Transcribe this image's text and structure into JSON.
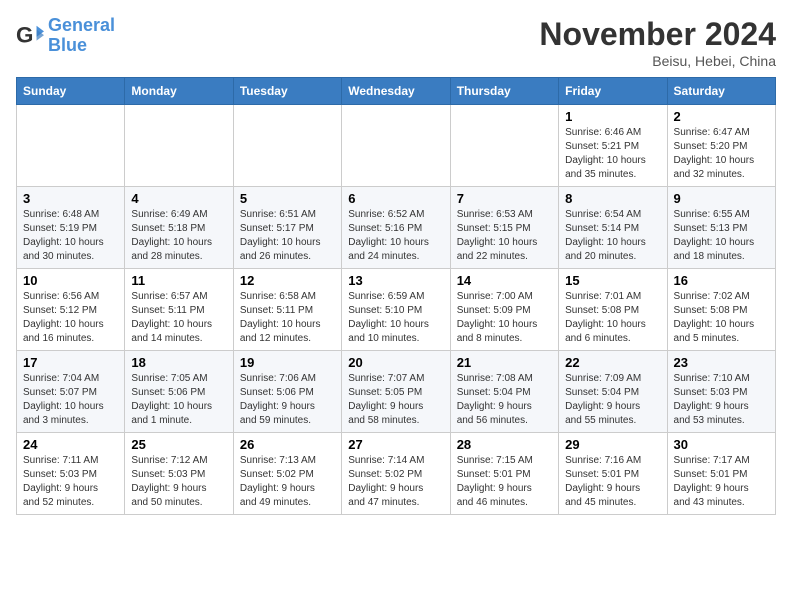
{
  "logo": {
    "line1": "General",
    "line2": "Blue"
  },
  "title": "November 2024",
  "location": "Beisu, Hebei, China",
  "days_of_week": [
    "Sunday",
    "Monday",
    "Tuesday",
    "Wednesday",
    "Thursday",
    "Friday",
    "Saturday"
  ],
  "weeks": [
    [
      {
        "day": "",
        "info": ""
      },
      {
        "day": "",
        "info": ""
      },
      {
        "day": "",
        "info": ""
      },
      {
        "day": "",
        "info": ""
      },
      {
        "day": "",
        "info": ""
      },
      {
        "day": "1",
        "info": "Sunrise: 6:46 AM\nSunset: 5:21 PM\nDaylight: 10 hours\nand 35 minutes."
      },
      {
        "day": "2",
        "info": "Sunrise: 6:47 AM\nSunset: 5:20 PM\nDaylight: 10 hours\nand 32 minutes."
      }
    ],
    [
      {
        "day": "3",
        "info": "Sunrise: 6:48 AM\nSunset: 5:19 PM\nDaylight: 10 hours\nand 30 minutes."
      },
      {
        "day": "4",
        "info": "Sunrise: 6:49 AM\nSunset: 5:18 PM\nDaylight: 10 hours\nand 28 minutes."
      },
      {
        "day": "5",
        "info": "Sunrise: 6:51 AM\nSunset: 5:17 PM\nDaylight: 10 hours\nand 26 minutes."
      },
      {
        "day": "6",
        "info": "Sunrise: 6:52 AM\nSunset: 5:16 PM\nDaylight: 10 hours\nand 24 minutes."
      },
      {
        "day": "7",
        "info": "Sunrise: 6:53 AM\nSunset: 5:15 PM\nDaylight: 10 hours\nand 22 minutes."
      },
      {
        "day": "8",
        "info": "Sunrise: 6:54 AM\nSunset: 5:14 PM\nDaylight: 10 hours\nand 20 minutes."
      },
      {
        "day": "9",
        "info": "Sunrise: 6:55 AM\nSunset: 5:13 PM\nDaylight: 10 hours\nand 18 minutes."
      }
    ],
    [
      {
        "day": "10",
        "info": "Sunrise: 6:56 AM\nSunset: 5:12 PM\nDaylight: 10 hours\nand 16 minutes."
      },
      {
        "day": "11",
        "info": "Sunrise: 6:57 AM\nSunset: 5:11 PM\nDaylight: 10 hours\nand 14 minutes."
      },
      {
        "day": "12",
        "info": "Sunrise: 6:58 AM\nSunset: 5:11 PM\nDaylight: 10 hours\nand 12 minutes."
      },
      {
        "day": "13",
        "info": "Sunrise: 6:59 AM\nSunset: 5:10 PM\nDaylight: 10 hours\nand 10 minutes."
      },
      {
        "day": "14",
        "info": "Sunrise: 7:00 AM\nSunset: 5:09 PM\nDaylight: 10 hours\nand 8 minutes."
      },
      {
        "day": "15",
        "info": "Sunrise: 7:01 AM\nSunset: 5:08 PM\nDaylight: 10 hours\nand 6 minutes."
      },
      {
        "day": "16",
        "info": "Sunrise: 7:02 AM\nSunset: 5:08 PM\nDaylight: 10 hours\nand 5 minutes."
      }
    ],
    [
      {
        "day": "17",
        "info": "Sunrise: 7:04 AM\nSunset: 5:07 PM\nDaylight: 10 hours\nand 3 minutes."
      },
      {
        "day": "18",
        "info": "Sunrise: 7:05 AM\nSunset: 5:06 PM\nDaylight: 10 hours\nand 1 minute."
      },
      {
        "day": "19",
        "info": "Sunrise: 7:06 AM\nSunset: 5:06 PM\nDaylight: 9 hours\nand 59 minutes."
      },
      {
        "day": "20",
        "info": "Sunrise: 7:07 AM\nSunset: 5:05 PM\nDaylight: 9 hours\nand 58 minutes."
      },
      {
        "day": "21",
        "info": "Sunrise: 7:08 AM\nSunset: 5:04 PM\nDaylight: 9 hours\nand 56 minutes."
      },
      {
        "day": "22",
        "info": "Sunrise: 7:09 AM\nSunset: 5:04 PM\nDaylight: 9 hours\nand 55 minutes."
      },
      {
        "day": "23",
        "info": "Sunrise: 7:10 AM\nSunset: 5:03 PM\nDaylight: 9 hours\nand 53 minutes."
      }
    ],
    [
      {
        "day": "24",
        "info": "Sunrise: 7:11 AM\nSunset: 5:03 PM\nDaylight: 9 hours\nand 52 minutes."
      },
      {
        "day": "25",
        "info": "Sunrise: 7:12 AM\nSunset: 5:03 PM\nDaylight: 9 hours\nand 50 minutes."
      },
      {
        "day": "26",
        "info": "Sunrise: 7:13 AM\nSunset: 5:02 PM\nDaylight: 9 hours\nand 49 minutes."
      },
      {
        "day": "27",
        "info": "Sunrise: 7:14 AM\nSunset: 5:02 PM\nDaylight: 9 hours\nand 47 minutes."
      },
      {
        "day": "28",
        "info": "Sunrise: 7:15 AM\nSunset: 5:01 PM\nDaylight: 9 hours\nand 46 minutes."
      },
      {
        "day": "29",
        "info": "Sunrise: 7:16 AM\nSunset: 5:01 PM\nDaylight: 9 hours\nand 45 minutes."
      },
      {
        "day": "30",
        "info": "Sunrise: 7:17 AM\nSunset: 5:01 PM\nDaylight: 9 hours\nand 43 minutes."
      }
    ]
  ]
}
